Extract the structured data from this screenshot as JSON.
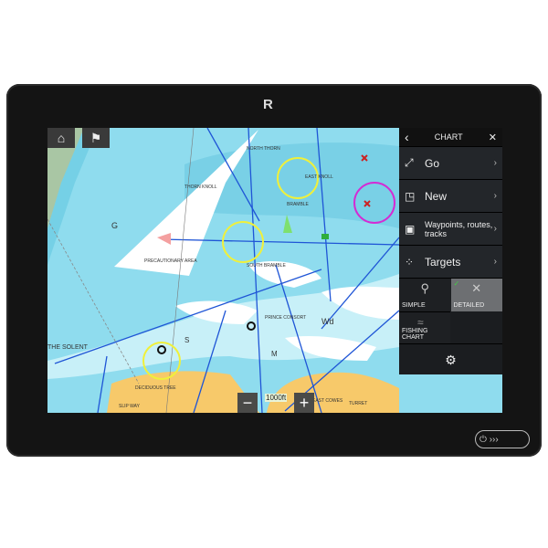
{
  "device": {
    "logo": "R",
    "power_glyph": "⏻ ›››"
  },
  "map": {
    "home_icon": "home-icon",
    "overlay_icon": "chart-flag-icon",
    "labels": [
      "NORTH THORN",
      "EAST KNOLL",
      "THORN KNOLL",
      "BRAMBLE",
      "PRECAUTIONARY AREA",
      "SOUTH BRAMBLE",
      "PRINCE CONSORT",
      "THE SOLENT",
      "DECIDUOUS TREE",
      "SLIP WAY",
      "EAST COWES",
      "TURRET",
      "Wd",
      "G",
      "M",
      "S"
    ],
    "scale": "1000ft",
    "zoom_out": "−",
    "zoom_in": "+",
    "colors": {
      "water": "#8fdcee",
      "deep": "#c8f0f8",
      "land": "#f7c96a",
      "route": "#1f55d6",
      "highlight": "#f0f03a",
      "magenta": "#d42bd4"
    }
  },
  "panel": {
    "title": "CHART",
    "back": "‹",
    "close": "✕",
    "items": [
      {
        "label": "Go",
        "icon": "go-icon",
        "glyph": "⤢"
      },
      {
        "label": "New",
        "icon": "new-icon",
        "glyph": "◳"
      },
      {
        "label": "Waypoints, routes, tracks",
        "icon": "waypoints-icon",
        "glyph": "▣"
      },
      {
        "label": "Targets",
        "icon": "targets-icon",
        "glyph": "⁘"
      }
    ],
    "modes": [
      {
        "label": "SIMPLE",
        "selected": false
      },
      {
        "label": "DETAILED",
        "selected": true
      },
      {
        "label": "FISHING CHART",
        "selected": false
      }
    ],
    "settings_icon": "settings-icon"
  }
}
